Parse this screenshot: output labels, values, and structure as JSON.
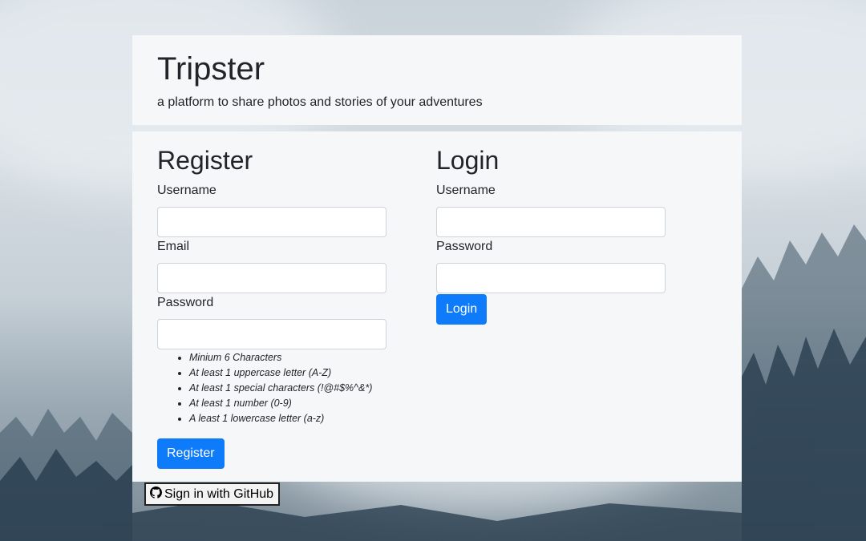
{
  "header": {
    "title": "Tripster",
    "tagline": "a platform to share photos and stories of your adventures"
  },
  "register": {
    "heading": "Register",
    "username_label": "Username",
    "email_label": "Email",
    "password_label": "Password",
    "password_rules": [
      "Minium 6 Characters",
      "At least 1 uppercase letter (A-Z)",
      "At least 1 special characters (!@#$%^&*)",
      "At least 1 number (0-9)",
      "A least 1 lowercase letter (a-z)"
    ],
    "submit_label": "Register"
  },
  "login": {
    "heading": "Login",
    "username_label": "Username",
    "password_label": "Password",
    "submit_label": "Login"
  },
  "github": {
    "label": "Sign in with GitHub",
    "icon": "github-icon"
  },
  "colors": {
    "primary": "#0d7bfa",
    "card": "#f6f7f9"
  }
}
